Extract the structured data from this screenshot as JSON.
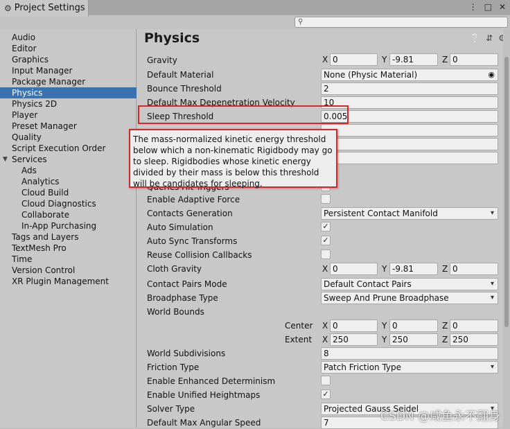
{
  "window": {
    "tab_title": "Project Settings",
    "search_placeholder": ""
  },
  "sidebar": {
    "items": [
      {
        "label": "Audio"
      },
      {
        "label": "Editor"
      },
      {
        "label": "Graphics"
      },
      {
        "label": "Input Manager"
      },
      {
        "label": "Package Manager"
      },
      {
        "label": "Physics",
        "selected": true
      },
      {
        "label": "Physics 2D"
      },
      {
        "label": "Player"
      },
      {
        "label": "Preset Manager"
      },
      {
        "label": "Quality"
      },
      {
        "label": "Script Execution Order"
      },
      {
        "label": "Services",
        "expanded": true
      },
      {
        "label": "Ads",
        "child": true
      },
      {
        "label": "Analytics",
        "child": true
      },
      {
        "label": "Cloud Build",
        "child": true
      },
      {
        "label": "Cloud Diagnostics",
        "child": true
      },
      {
        "label": "Collaborate",
        "child": true
      },
      {
        "label": "In-App Purchasing",
        "child": true
      },
      {
        "label": "Tags and Layers"
      },
      {
        "label": "TextMesh Pro"
      },
      {
        "label": "Time"
      },
      {
        "label": "Version Control"
      },
      {
        "label": "XR Plugin Management"
      }
    ]
  },
  "main": {
    "title": "Physics",
    "gravity": {
      "label": "Gravity",
      "x": "0",
      "y": "-9.81",
      "z": "0"
    },
    "default_material": {
      "label": "Default Material",
      "value": "None (Physic Material)"
    },
    "bounce_threshold": {
      "label": "Bounce Threshold",
      "value": "2"
    },
    "default_max_depenetration": {
      "label": "Default Max Depenetration Velocity",
      "value": "10"
    },
    "sleep_threshold": {
      "label": "Sleep Threshold",
      "value": "0.005"
    },
    "queries_hit_triggers": {
      "label": "Queries Hit Triggers"
    },
    "enable_adaptive_force": {
      "label": "Enable Adaptive Force",
      "checked": false
    },
    "contacts_generation": {
      "label": "Contacts Generation",
      "value": "Persistent Contact Manifold"
    },
    "auto_simulation": {
      "label": "Auto Simulation",
      "checked": true
    },
    "auto_sync_transforms": {
      "label": "Auto Sync Transforms",
      "checked": true
    },
    "reuse_collision_callbacks": {
      "label": "Reuse Collision Callbacks",
      "checked": false
    },
    "cloth_gravity": {
      "label": "Cloth Gravity",
      "x": "0",
      "y": "-9.81",
      "z": "0"
    },
    "contact_pairs_mode": {
      "label": "Contact Pairs Mode",
      "value": "Default Contact Pairs"
    },
    "broadphase_type": {
      "label": "Broadphase Type",
      "value": "Sweep And Prune Broadphase"
    },
    "world_bounds": {
      "label": "World Bounds",
      "center_label": "Center",
      "extent_label": "Extent",
      "center": {
        "x": "0",
        "y": "0",
        "z": "0"
      },
      "extent": {
        "x": "250",
        "y": "250",
        "z": "250"
      }
    },
    "world_subdivisions": {
      "label": "World Subdivisions",
      "value": "8"
    },
    "friction_type": {
      "label": "Friction Type",
      "value": "Patch Friction Type"
    },
    "enable_enhanced_determinism": {
      "label": "Enable Enhanced Determinism",
      "checked": false
    },
    "enable_unified_heightmaps": {
      "label": "Enable Unified Heightmaps",
      "checked": true
    },
    "solver_type": {
      "label": "Solver Type",
      "value": "Projected Gauss Seidel"
    },
    "default_max_angular_speed": {
      "label": "Default Max Angular Speed",
      "value": "7"
    },
    "axis": {
      "x": "X",
      "y": "Y",
      "z": "Z"
    }
  },
  "tooltip": {
    "text": "The mass-normalized kinetic energy threshold below which a non-kinematic Rigidbody may go to sleep. Rigidbodies whose kinetic energy divided by their mass is below this threshold will be candidates for sleeping."
  },
  "watermark": {
    "text": "CSDN @咸鱼永不翻身"
  },
  "colors": {
    "accent": "#3a72b0",
    "highlight": "#d9262a"
  },
  "icons": [
    "gear-icon",
    "menu-icon",
    "maximize-icon",
    "close-icon",
    "search-icon",
    "help-icon",
    "preset-icon",
    "settings-icon",
    "object-picker-icon",
    "chevron-down-icon",
    "checkmark-icon",
    "expand-triangle-icon"
  ]
}
